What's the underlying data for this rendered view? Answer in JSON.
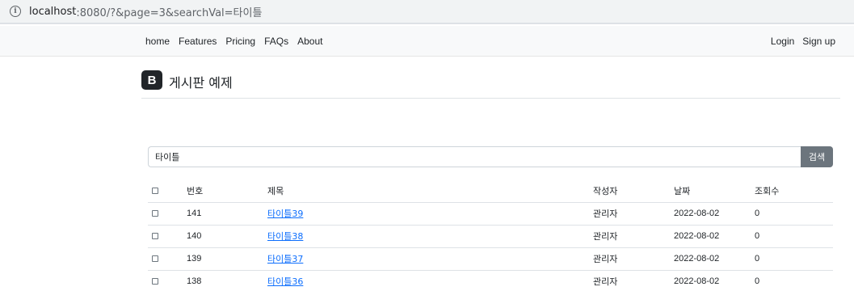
{
  "browser": {
    "url_host": "localhost",
    "url_rest": ":8080/?&page=3&searchVal=타이틀"
  },
  "navbar": {
    "left_links": [
      "home",
      "Features",
      "Pricing",
      "FAQs",
      "About"
    ],
    "right_links": [
      "Login",
      "Sign up"
    ]
  },
  "header": {
    "logo_letter": "B",
    "title": "게시판 예제"
  },
  "search": {
    "value": "타이틀",
    "button_label": "검색"
  },
  "table": {
    "headers": {
      "number": "번호",
      "title": "제목",
      "author": "작성자",
      "date": "날짜",
      "views": "조회수"
    },
    "rows": [
      {
        "number": "141",
        "title": "타이틀39",
        "author": "관리자",
        "date": "2022-08-02",
        "views": "0"
      },
      {
        "number": "140",
        "title": "타이틀38",
        "author": "관리자",
        "date": "2022-08-02",
        "views": "0"
      },
      {
        "number": "139",
        "title": "타이틀37",
        "author": "관리자",
        "date": "2022-08-02",
        "views": "0"
      },
      {
        "number": "138",
        "title": "타이틀36",
        "author": "관리자",
        "date": "2022-08-02",
        "views": "0"
      }
    ]
  },
  "colors": {
    "link": "#0d6efd",
    "button": "#6c757d",
    "navbar_bg": "#f8f9fa"
  }
}
